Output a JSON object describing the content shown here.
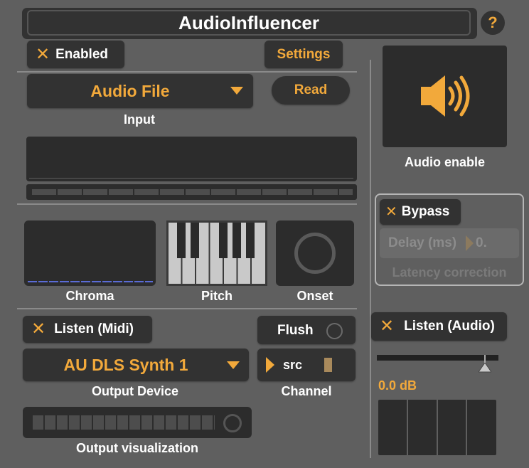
{
  "title": "AudioInfluencer",
  "help_glyph": "?",
  "enabled": {
    "label": "Enabled",
    "checked": true,
    "check_glyph": "✕"
  },
  "settings_label": "Settings",
  "input": {
    "selected": "Audio File",
    "read_label": "Read",
    "section_label": "Input"
  },
  "analysis": {
    "chroma_label": "Chroma",
    "pitch_label": "Pitch",
    "onset_label": "Onset"
  },
  "listen_midi": {
    "label": "Listen (Midi)",
    "checked": true,
    "check_glyph": "✕"
  },
  "flush_label": "Flush",
  "output_device": {
    "selected": "AU DLS Synth 1",
    "section_label": "Output Device"
  },
  "channel": {
    "value": "src",
    "section_label": "Channel"
  },
  "output_visualization_label": "Output visualization",
  "audio_enable_label": "Audio enable",
  "bypass": {
    "label": "Bypass",
    "checked": true,
    "check_glyph": "✕"
  },
  "delay": {
    "label": "Delay (ms)",
    "value": "0."
  },
  "latency_label": "Latency correction",
  "listen_audio": {
    "label": "Listen (Audio)",
    "checked": true,
    "check_glyph": "✕"
  },
  "gain_db": "0.0 dB",
  "colors": {
    "accent": "#f2a93b",
    "background": "#5f5f5f",
    "panel": "#2c2c2c",
    "chroma_line": "#5a6bd6"
  },
  "icons": {
    "speaker": "speaker-on-icon",
    "dropdown": "triangle-down-icon"
  }
}
